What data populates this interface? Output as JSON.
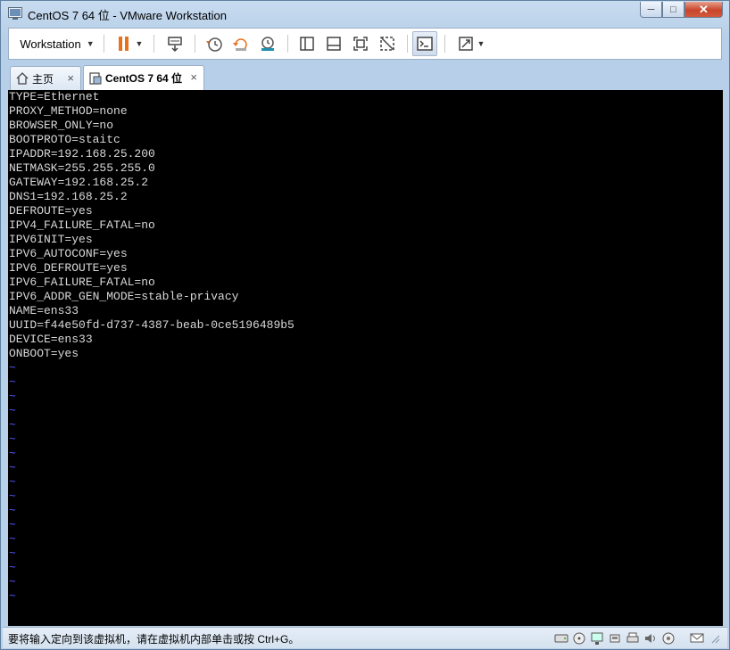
{
  "window": {
    "title": "CentOS 7 64 位 - VMware Workstation",
    "controls": {
      "minimize": "─",
      "maximize": "□",
      "close": "✕"
    }
  },
  "toolbar": {
    "menu_label": "Workstation",
    "icons": [
      "pause-icon",
      "send-ctrl-alt-del-icon",
      "snapshot-icon",
      "revert-snapshot-icon",
      "snapshot-manager-icon",
      "library-view-icon",
      "single-window-icon",
      "fullscreen-icon",
      "unity-icon",
      "console-view-icon",
      "stretch-icon"
    ],
    "accent_color": "#e8711c"
  },
  "tabs": [
    {
      "label": "主页",
      "icon": "home-icon",
      "close": "×"
    },
    {
      "label": "CentOS 7 64 位",
      "icon": "vm-icon",
      "close": "×",
      "active": true
    }
  ],
  "console": {
    "lines": [
      "TYPE=Ethernet",
      "PROXY_METHOD=none",
      "BROWSER_ONLY=no",
      "BOOTPROTO=staitc",
      "IPADDR=192.168.25.200",
      "NETMASK=255.255.255.0",
      "GATEWAY=192.168.25.2",
      "DNS1=192.168.25.2",
      "DEFROUTE=yes",
      "IPV4_FAILURE_FATAL=no",
      "IPV6INIT=yes",
      "IPV6_AUTOCONF=yes",
      "IPV6_DEFROUTE=yes",
      "IPV6_FAILURE_FATAL=no",
      "IPV6_ADDR_GEN_MODE=stable-privacy",
      "NAME=ens33",
      "UUID=f44e50fd-d737-4387-beab-0ce5196489b5",
      "DEVICE=ens33",
      "ONBOOT=yes"
    ],
    "tilde_lines": [
      "~",
      "~",
      "~",
      "~",
      "~",
      "~",
      "~",
      "~",
      "~",
      "~",
      "~",
      "~",
      "~",
      "~",
      "~",
      "~",
      "~"
    ],
    "text_color": "#d8d8d8",
    "tilde_color": "#5a5aff"
  },
  "statusbar": {
    "text": "要将输入定向到该虚拟机，请在虚拟机内部单击或按 Ctrl+G。",
    "icons": [
      "hard-disk-icon",
      "cd-drive-icon",
      "network-icon",
      "usb-icon",
      "printer-icon",
      "sound-icon",
      "display-icon",
      "message-icon"
    ]
  }
}
